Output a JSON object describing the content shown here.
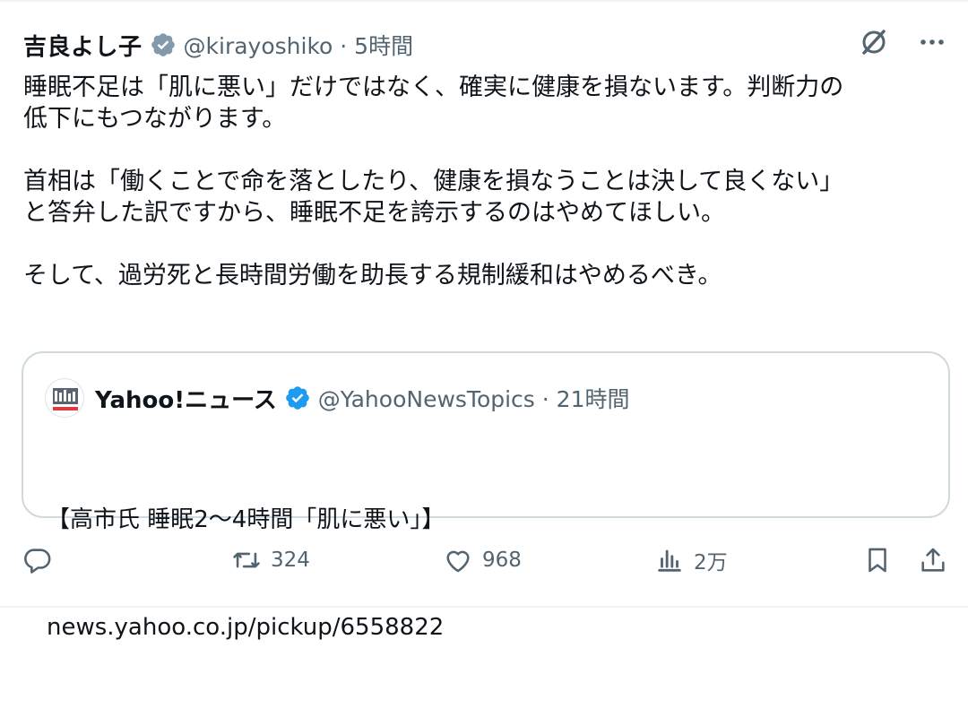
{
  "tweet": {
    "author_name": "吉良よし子",
    "handle_meta": "@kirayoshiko · 5時間",
    "text": "睡眠不足は「肌に悪い」だけではなく、確実に健康を損ないます。判断力の\n低下にもつながります。\n\n首相は「働くことで命を落としたり、健康を損なうことは決して良くない」\nと答弁した訳ですから、睡眠不足を誇示するのはやめてほしい。\n\nそして、過労死と長時間労働を助長する規制緩和はやめるべき。"
  },
  "quote": {
    "name": "Yahoo!ニュース",
    "meta": "@YahooNewsTopics · 21時間",
    "line1": "【高市氏 睡眠2〜4時間「肌に悪い」】",
    "line2": "news.yahoo.co.jp/pickup/6558822"
  },
  "actions": {
    "retweets": "324",
    "likes": "968",
    "views": "2万"
  },
  "icons": [
    "verified-icon",
    "grok-icon",
    "more-icon",
    "reply-icon",
    "retweet-icon",
    "like-icon",
    "views-icon",
    "bookmark-icon",
    "share-icon"
  ],
  "colors": {
    "verified": "#829aab",
    "quote_verified": "#1d9bf0",
    "text": "#0f1419",
    "muted": "#536471",
    "border": "#cfd9de"
  }
}
